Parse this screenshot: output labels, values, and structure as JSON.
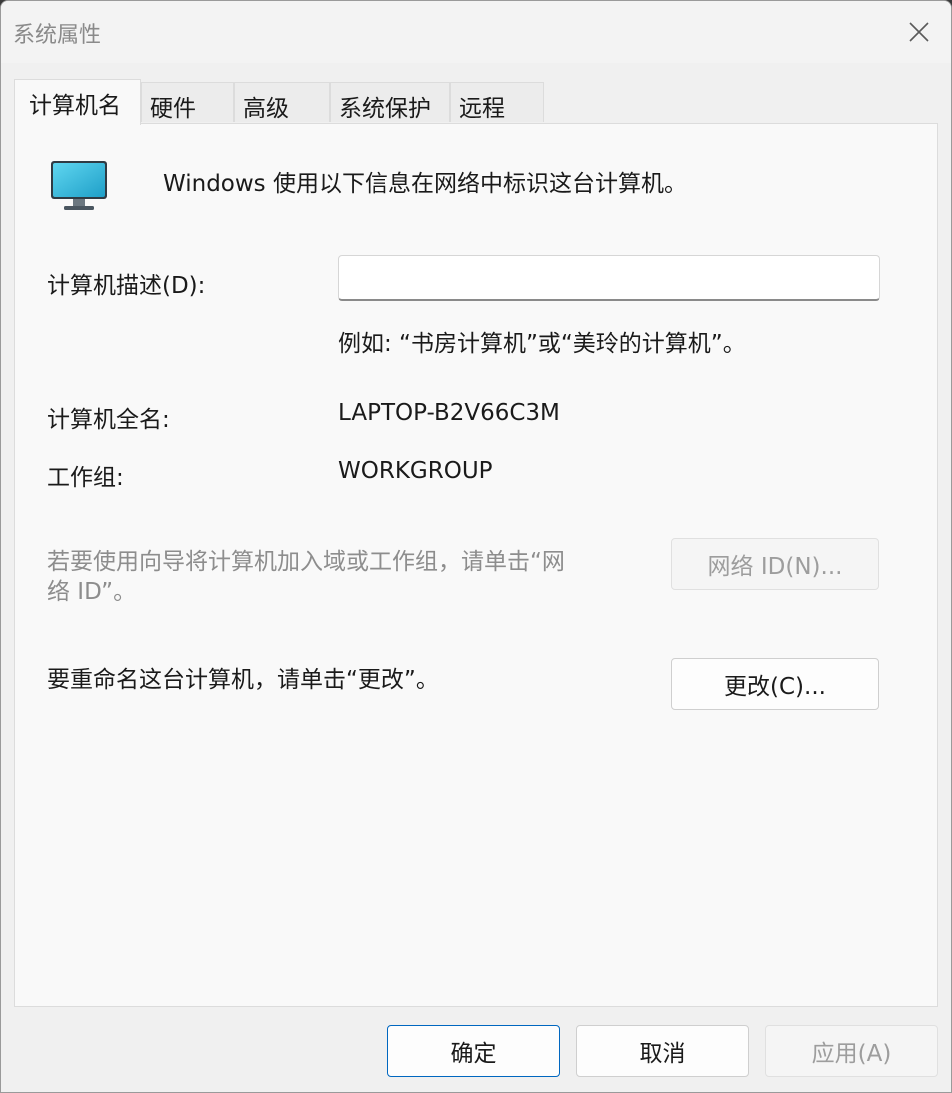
{
  "window": {
    "title": "系统属性"
  },
  "tabs": [
    {
      "label": "计算机名",
      "active": true
    },
    {
      "label": "硬件",
      "active": false
    },
    {
      "label": "高级",
      "active": false
    },
    {
      "label": "系统保护",
      "active": false
    },
    {
      "label": "远程",
      "active": false
    }
  ],
  "computer_name": {
    "intro": "Windows 使用以下信息在网络中标识这台计算机。",
    "description_label": "计算机描述(D):",
    "description_value": "",
    "description_example": "例如: “书房计算机”或“美玲的计算机”。",
    "full_name_label": "计算机全名:",
    "full_name_value": "LAPTOP-B2V66C3M",
    "workgroup_label": "工作组:",
    "workgroup_value": "WORKGROUP",
    "network_id_text_line1": "若要使用向导将计算机加入域或工作组，请单击“网",
    "network_id_text_line2": "络 ID”。",
    "network_id_button": "网络 ID(N)...",
    "rename_text": "要重命名这台计算机，请单击“更改”。",
    "change_button": "更改(C)..."
  },
  "footer": {
    "ok_button": "确定",
    "cancel_button": "取消",
    "apply_button": "应用(A)"
  },
  "icons": {
    "monitor": "monitor-icon",
    "close": "close-icon"
  },
  "colors": {
    "accent": "#0067c0",
    "monitor_screen": "#3ec7e8"
  }
}
